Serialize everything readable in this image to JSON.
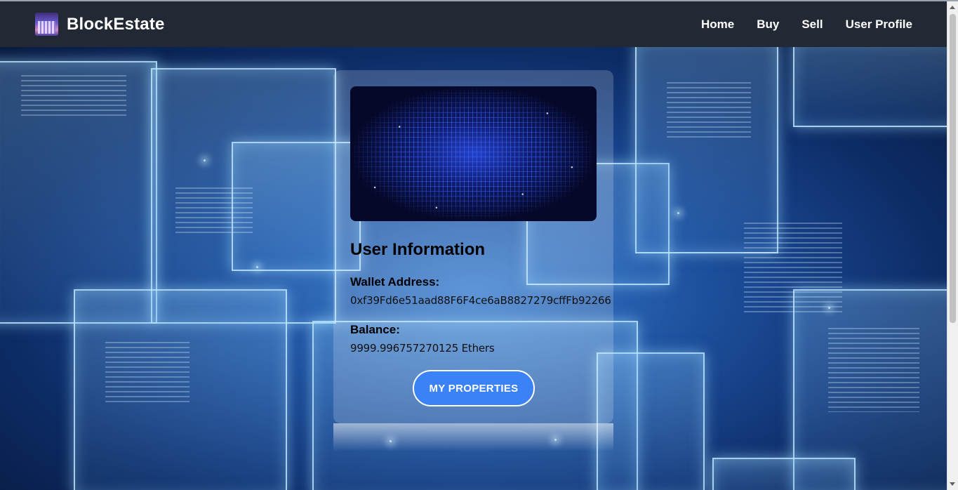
{
  "navbar": {
    "brand": "BlockEstate",
    "links": [
      "Home",
      "Buy",
      "Sell",
      "User Profile"
    ]
  },
  "profile": {
    "title": "User Information",
    "wallet_label": "Wallet Address:",
    "wallet_value": "0xf39Fd6e51aad88F6F4ce6aB8827279cffFb92266",
    "balance_label": "Balance:",
    "balance_value": "9999.996757270125 Ethers",
    "button_label": "MY PROPERTIES"
  },
  "colors": {
    "navbar_bg": "#222935",
    "button_bg": "#3b82f6"
  },
  "icons": {
    "logo": "city-logo-icon"
  }
}
